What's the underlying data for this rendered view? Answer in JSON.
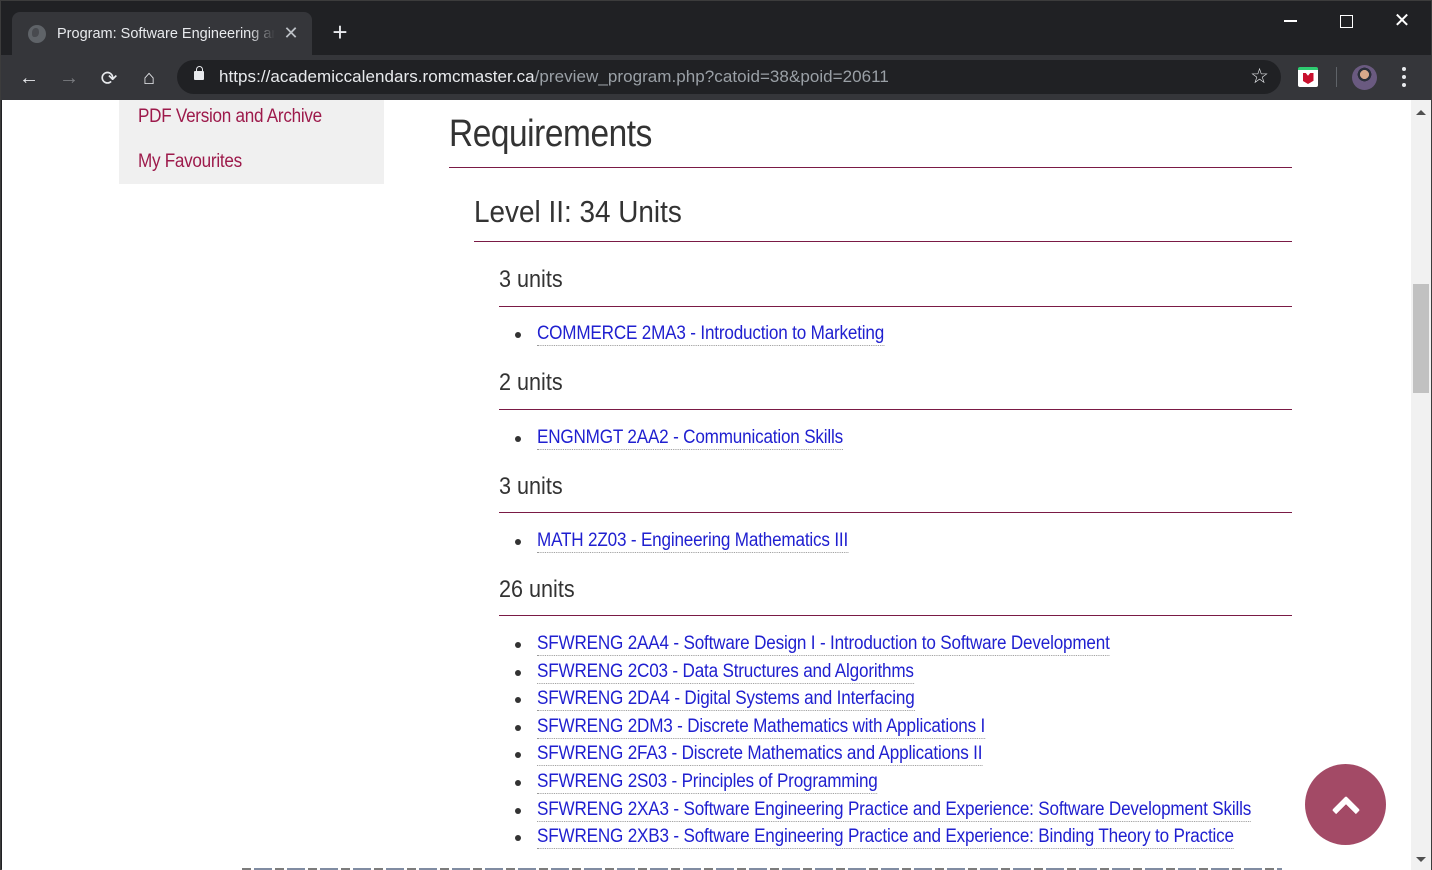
{
  "browser": {
    "tab": {
      "title": "Program: Software Engineering and Society - Co-op (B.Eng.Society)",
      "favicon": "globe-icon",
      "close_icon": "close-icon"
    },
    "new_tab_icon": "plus-icon",
    "window_controls": {
      "minimize": "minimize-icon",
      "maximize": "maximize-icon",
      "close": "close-icon"
    },
    "nav": {
      "back": "←",
      "forward": "→",
      "reload": "⟳",
      "home": "⌂"
    },
    "address": {
      "host": "https://academiccalendars.romcmaster.ca",
      "path": "/preview_program.php?catoid=38&poid=20611",
      "bookmark_icon": "☆"
    },
    "extension": "mcafee-extension-icon",
    "profile": "profile-avatar",
    "menu_icon": "kebab-menu-icon"
  },
  "sidebar": {
    "links": [
      "PDF Version and Archive",
      "My Favourites"
    ]
  },
  "main": {
    "heading": "Requirements",
    "level": {
      "title": "Level II: 34 Units",
      "groups": [
        {
          "units": "3 units",
          "courses": [
            "COMMERCE 2MA3 - Introduction to Marketing"
          ]
        },
        {
          "units": "2 units",
          "courses": [
            "ENGNMGT 2AA2 - Communication Skills"
          ]
        },
        {
          "units": "3 units",
          "courses": [
            "MATH 2Z03 - Engineering Mathematics III"
          ]
        },
        {
          "units": "26 units",
          "courses": [
            "SFWRENG 2AA4 - Software Design I - Introduction to Software Development",
            "SFWRENG 2C03 - Data Structures and Algorithms",
            "SFWRENG 2DA4 - Digital Systems and Interfacing",
            "SFWRENG 2DM3 - Discrete Mathematics with Applications I",
            "SFWRENG 2FA3 - Discrete Mathematics and Applications II",
            "SFWRENG 2S03 - Principles of Programming",
            "SFWRENG 2XA3 - Software Engineering Practice and Experience: Software Development Skills",
            "SFWRENG 2XB3 - Software Engineering Practice and Experience: Binding Theory to Practice"
          ]
        }
      ]
    }
  },
  "back_to_top": {
    "icon": "chevron-up-icon"
  },
  "colors": {
    "accent": "#7a1a45",
    "link": "#2020d0",
    "sidebar_link": "#9d1a4b",
    "back_to_top": "#a34a66"
  }
}
